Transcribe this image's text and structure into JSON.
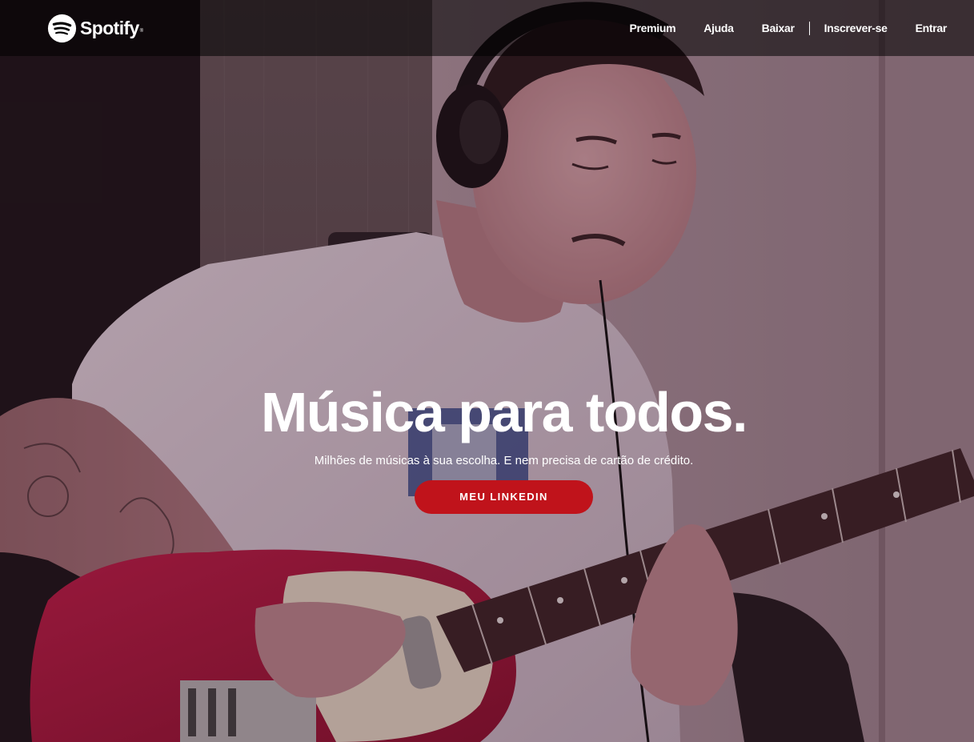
{
  "brand": {
    "name": "Spotify",
    "registered_mark": "®",
    "accent_color": "#c0131b"
  },
  "nav": {
    "items": [
      "Premium",
      "Ajuda",
      "Baixar",
      "Inscrever-se",
      "Entrar"
    ]
  },
  "hero": {
    "title": "Música para todos.",
    "subtitle": "Milhões de músicas à sua escolha. E nem precisa de cartão de crédito.",
    "cta_label": "MEU LINKEDIN",
    "image": "photo of a man with headphones playing a red electric guitar"
  }
}
